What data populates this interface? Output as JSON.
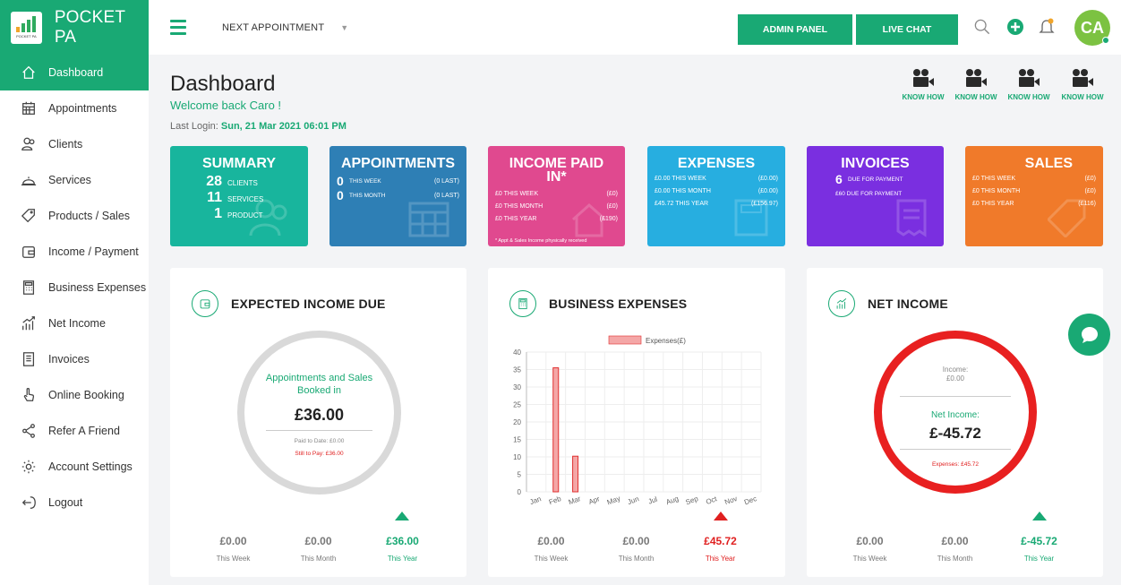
{
  "app": {
    "name": "POCKET PA",
    "logo_sub": "POCKET PA"
  },
  "sidebar": {
    "items": [
      {
        "label": "Dashboard",
        "icon": "home-icon"
      },
      {
        "label": "Appointments",
        "icon": "calendar-icon"
      },
      {
        "label": "Clients",
        "icon": "users-icon"
      },
      {
        "label": "Services",
        "icon": "service-bell-icon"
      },
      {
        "label": "Products / Sales",
        "icon": "tag-icon"
      },
      {
        "label": "Income / Payment",
        "icon": "wallet-icon"
      },
      {
        "label": "Business Expenses",
        "icon": "calculator-icon"
      },
      {
        "label": "Net Income",
        "icon": "chart-trend-icon"
      },
      {
        "label": "Invoices",
        "icon": "invoice-icon"
      },
      {
        "label": "Online Booking",
        "icon": "click-icon"
      },
      {
        "label": "Refer A Friend",
        "icon": "share-icon"
      },
      {
        "label": "Account Settings",
        "icon": "gear-icon"
      },
      {
        "label": "Logout",
        "icon": "logout-icon"
      }
    ]
  },
  "topbar": {
    "next_appointment": "NEXT APPOINTMENT",
    "admin_panel": "ADMIN PANEL",
    "live_chat": "LIVE CHAT",
    "avatar_initials": "CA"
  },
  "header": {
    "title": "Dashboard",
    "welcome": "Welcome back Caro !",
    "last_login_label": "Last Login:",
    "last_login_value": "Sun, 21 Mar 2021 06:01 PM",
    "know_how": [
      "KNOW HOW",
      "KNOW HOW",
      "KNOW HOW",
      "KNOW HOW"
    ]
  },
  "cards": {
    "summary": {
      "title": "SUMMARY",
      "lines": [
        {
          "num": "28",
          "label": "CLIENTS"
        },
        {
          "num": "11",
          "label": "SERVICES"
        },
        {
          "num": "1",
          "label": "PRODUCT"
        }
      ]
    },
    "appointments": {
      "title": "APPOINTMENTS",
      "lines": [
        {
          "num": "0",
          "label": "THIS WEEK",
          "value": "(0 LAST)"
        },
        {
          "num": "0",
          "label": "THIS MONTH",
          "value": "(0 LAST)"
        }
      ]
    },
    "income_paid": {
      "title_line1": "INCOME PAID",
      "title_line2": "IN*",
      "rows": [
        {
          "label": "£0 THIS WEEK",
          "value": "(£0)"
        },
        {
          "label": "£0 THIS MONTH",
          "value": "(£0)"
        },
        {
          "label": "£0 THIS YEAR",
          "value": "(£190)"
        }
      ],
      "note": "* Appt & Sales Income physically received"
    },
    "expenses": {
      "title": "EXPENSES",
      "rows": [
        {
          "label": "£0.00 THIS WEEK",
          "value": "(£0.00)"
        },
        {
          "label": "£0.00 THIS MONTH",
          "value": "(£0.00)"
        },
        {
          "label": "£45.72 THIS YEAR",
          "value": "(£156.97)"
        }
      ]
    },
    "invoices": {
      "title": "INVOICES",
      "num": "6",
      "due_label": "DUE FOR PAYMENT",
      "due_amount": "£60 DUE FOR PAYMENT"
    },
    "sales": {
      "title": "SALES",
      "rows": [
        {
          "label": "£0 THIS WEEK",
          "value": "(£0)"
        },
        {
          "label": "£0 THIS MONTH",
          "value": "(£0)"
        },
        {
          "label": "£0 THIS YEAR",
          "value": "(£116)"
        }
      ]
    }
  },
  "panels": {
    "expected": {
      "title": "EXPECTED INCOME DUE",
      "ring_label": "Appointments and Sales Booked in",
      "amount": "£36.00",
      "paid": "Paid to Date: £0.00",
      "still": "Still to Pay: £36.00",
      "footer": [
        {
          "value": "£0.00",
          "label": "This Week"
        },
        {
          "value": "£0.00",
          "label": "This Month"
        },
        {
          "value": "£36.00",
          "label": "This Year"
        }
      ]
    },
    "expenses": {
      "title": "BUSINESS EXPENSES",
      "footer": [
        {
          "value": "£0.00",
          "label": "This Week"
        },
        {
          "value": "£0.00",
          "label": "This Month"
        },
        {
          "value": "£45.72",
          "label": "This Year"
        }
      ]
    },
    "net": {
      "title": "NET INCOME",
      "income_label": "Income:",
      "income_value": "£0.00",
      "net_label": "Net Income:",
      "amount": "£-45.72",
      "expenses": "Expenses: £45.72",
      "footer": [
        {
          "value": "£0.00",
          "label": "This Week"
        },
        {
          "value": "£0.00",
          "label": "This Month"
        },
        {
          "value": "£-45.72",
          "label": "This Year"
        }
      ]
    }
  },
  "chart_data": {
    "type": "bar",
    "categories": [
      "Jan",
      "Feb",
      "Mar",
      "Apr",
      "May",
      "Jun",
      "Jul",
      "Aug",
      "Sep",
      "Oct",
      "Nov",
      "Dec"
    ],
    "series": [
      {
        "name": "Expenses(£)",
        "values": [
          0,
          35.5,
          10.2,
          0,
          0,
          0,
          0,
          0,
          0,
          0,
          0,
          0
        ]
      }
    ],
    "ylim": [
      0,
      40
    ],
    "yticks": [
      0,
      5,
      10,
      15,
      20,
      25,
      30,
      35,
      40
    ],
    "bar_color": "#f4a7a7",
    "bar_stroke": "#e03030",
    "legend": "top"
  },
  "colors": {
    "accent": "#19a974",
    "summary": "#18b59d",
    "appointments": "#2e7fb5",
    "income": "#e0498f",
    "expenses": "#27aee0",
    "invoices": "#7a2fe0",
    "sales": "#f07a2a",
    "negative": "#e02020"
  }
}
